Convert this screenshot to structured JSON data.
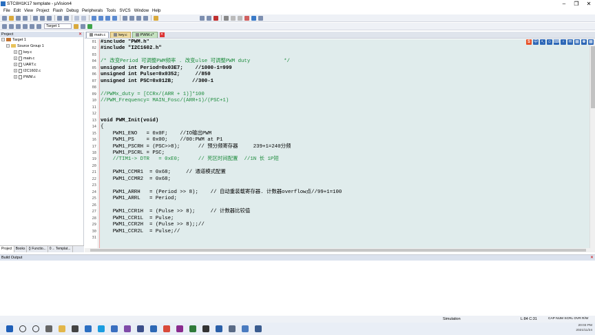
{
  "window": {
    "title": "STC8H1K17 template - µVision4"
  },
  "menu": [
    "File",
    "Edit",
    "View",
    "Project",
    "Flash",
    "Debug",
    "Peripherals",
    "Tools",
    "SVCS",
    "Window",
    "Help"
  ],
  "toolbar": {
    "target": "Target 1"
  },
  "project_panel": {
    "title": "Project",
    "tree": {
      "target": "Target 1",
      "group": "Source Group 1",
      "files": [
        "key.c",
        "main.c",
        "UART.c",
        "I2C1602.c",
        "PWM.c"
      ]
    },
    "tabs": [
      "Project",
      "Books",
      "{} Functio...",
      "0→ Templat..."
    ]
  },
  "editor": {
    "tabs": [
      {
        "label": "main.c",
        "active": true
      },
      {
        "label": "key.c",
        "active": false
      },
      {
        "label": "PWM.c*",
        "active": false
      }
    ],
    "ribbon": [
      "S",
      "中",
      "•,",
      "☺",
      "⌨",
      "♀",
      "✉",
      "▦",
      "♚",
      "▦"
    ],
    "line_numbers": [
      "01",
      "02",
      "03",
      "04",
      "05",
      "06",
      "07",
      "08",
      "09",
      "10",
      "11",
      "12",
      "13",
      "14",
      "15",
      "16",
      "17",
      "18",
      "19",
      "20",
      "21",
      "22",
      "23",
      "24",
      "25",
      "26",
      "27",
      "28",
      "29",
      "30",
      "31"
    ],
    "code": [
      {
        "t": "#include \"PWM.h\"",
        "c": "kw"
      },
      {
        "t": "#include \"I2C1602.h\"",
        "c": "kw"
      },
      {
        "t": "",
        "c": ""
      },
      {
        "t": "/* 改变Period 可调整PWM频率 . 改变ulse 可调整PWM duty           */",
        "c": "cm"
      },
      {
        "t": "unsigned int Period=0x03E7;    //1000-1=999",
        "c": "kw"
      },
      {
        "t": "unsigned int Pulse=0x0352;     //850",
        "c": "kw"
      },
      {
        "t": "unsigned int PSC=0x012B;      //300-1",
        "c": "kw"
      },
      {
        "t": "",
        "c": ""
      },
      {
        "t": "//PWMx_duty = [CCRx/(ARR + 1)]*100",
        "c": "cm"
      },
      {
        "t": "//PWM_Frequency= MAIN_Fosc/(ARR+1)/(PSC+1)",
        "c": "cm"
      },
      {
        "t": "",
        "c": ""
      },
      {
        "t": "",
        "c": ""
      },
      {
        "t": "void PWM_Init(void)",
        "c": "kw"
      },
      {
        "t": "{",
        "c": ""
      },
      {
        "t": "    PWM1_ENO   = 0x0F;    //IO输出PWM",
        "c": ""
      },
      {
        "t": "    PWM1_PS    = 0x00;    //00:PWM at P1",
        "c": ""
      },
      {
        "t": "    PWM1_PSCRH = (PSC>>8);      // 预分频寄存器     239+1=240分频",
        "c": ""
      },
      {
        "t": "    PWM1_PSCRL = PSC;",
        "c": ""
      },
      {
        "t": "    //TIM1-> DTR   = 0xE0;      // 死区时间配置  //1N 长 1P短",
        "c": "cm"
      },
      {
        "t": "",
        "c": ""
      },
      {
        "t": "    PWM1_CCMR1  = 0x68;     // 通道模式配置",
        "c": ""
      },
      {
        "t": "    PWM1_CCMR2  = 0x68;",
        "c": ""
      },
      {
        "t": "",
        "c": ""
      },
      {
        "t": "    PWM1_ARRH   = (Period >> 8);    // 自动重装载寄存器. 计数器overflow点//99+1=100",
        "c": ""
      },
      {
        "t": "    PWM1_ARRL   = Period;",
        "c": ""
      },
      {
        "t": "",
        "c": ""
      },
      {
        "t": "    PWM1_CCR1H  = (Pulse >> 8);     // 计数器比较值",
        "c": ""
      },
      {
        "t": "    PWM1_CCR1L  = Pulse;",
        "c": ""
      },
      {
        "t": "    PWM1_CCR2H  = (Pulse >> 8);;//",
        "c": ""
      },
      {
        "t": "    PWM1_CCR2L  = Pulse;//",
        "c": ""
      },
      {
        "t": "",
        "c": ""
      }
    ]
  },
  "build_output": {
    "title": "Build Output"
  },
  "status": {
    "mode": "Simulation",
    "position": "L:84 C:31",
    "keys": "CAP  NUM  SCRL  OVR  R/W"
  },
  "tray": {
    "time": "20:03 PM",
    "date": "2021/11/24"
  },
  "colors": {
    "code_bg": "#e0ecec",
    "comment": "#1a8a3a",
    "keyword": "#000000"
  }
}
